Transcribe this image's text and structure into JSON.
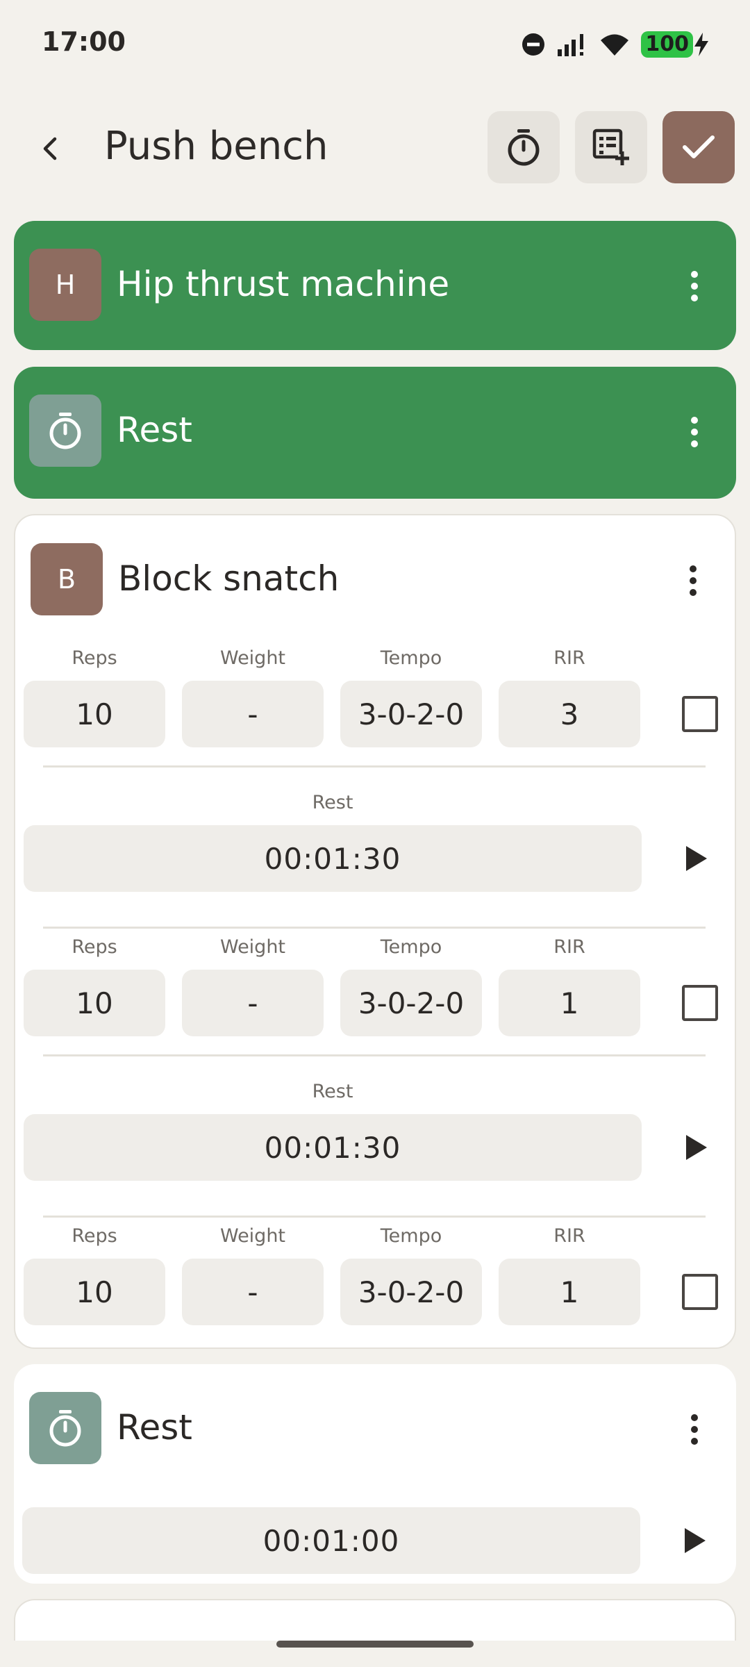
{
  "status_bar": {
    "time": "17:00",
    "battery": "100",
    "icons": [
      "do-not-disturb-icon",
      "signal-icon",
      "wifi-icon",
      "battery-icon",
      "charging-bolt-icon"
    ]
  },
  "header": {
    "title": "Push bench",
    "actions": [
      "timer-icon",
      "add-list-icon",
      "check-icon"
    ]
  },
  "exercises": [
    {
      "name": "Hip thrust machine",
      "avatar": "H",
      "state": "completed"
    },
    {
      "name": "Rest",
      "avatar_icon": "timer-icon",
      "state": "completed"
    },
    {
      "name": "Block snatch",
      "avatar": "B",
      "state": "active",
      "column_labels": {
        "reps": "Reps",
        "weight": "Weight",
        "tempo": "Tempo",
        "rir": "RIR"
      },
      "rest_label": "Rest",
      "sets": [
        {
          "reps": "10",
          "weight": "-",
          "tempo": "3-0-2-0",
          "rir": "3",
          "rest": "00:01:30"
        },
        {
          "reps": "10",
          "weight": "-",
          "tempo": "3-0-2-0",
          "rir": "1",
          "rest": "00:01:30"
        },
        {
          "reps": "10",
          "weight": "-",
          "tempo": "3-0-2-0",
          "rir": "1"
        }
      ]
    },
    {
      "name": "Rest",
      "avatar_icon": "timer-icon",
      "state": "pending",
      "duration": "00:01:00"
    }
  ],
  "colors": {
    "completed": "#3c9152",
    "accent": "#8c6a5e",
    "background": "#f3f1ec"
  }
}
